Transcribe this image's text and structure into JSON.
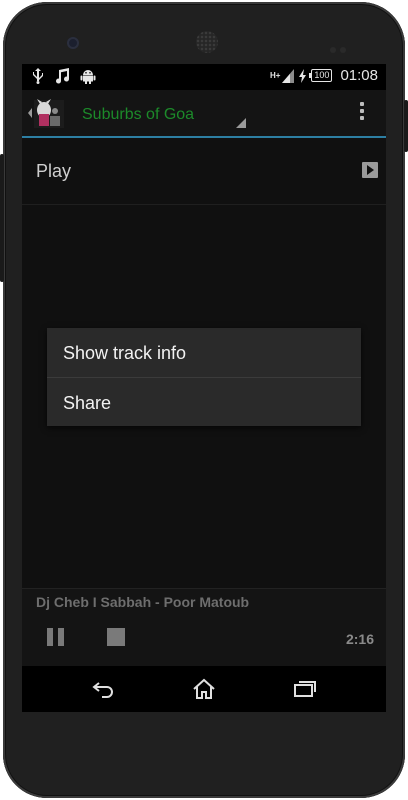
{
  "status_bar": {
    "left_icons": [
      "usb-icon",
      "music-note-icon",
      "android-icon"
    ],
    "signal_label": "H+",
    "battery_level": "100",
    "time": "01:08"
  },
  "action_bar": {
    "album_art_icon": "album-art-thumbnail",
    "station_title": "Suburbs of Goa",
    "title_color": "#1c8a2a",
    "overflow_icon": "overflow-menu-icon",
    "accent_color": "#2d7fa3"
  },
  "content": {
    "play_label": "Play",
    "play_icon": "play-icon"
  },
  "context_menu": {
    "items": [
      {
        "label": "Show track info"
      },
      {
        "label": "Share"
      }
    ]
  },
  "now_playing": {
    "track": "Dj Cheb I Sabbah - Poor Matoub",
    "elapsed": "2:16",
    "pause_icon": "pause-icon",
    "stop_icon": "stop-icon"
  },
  "nav_bar": {
    "icons": [
      "back-icon",
      "home-icon",
      "recents-icon"
    ]
  }
}
